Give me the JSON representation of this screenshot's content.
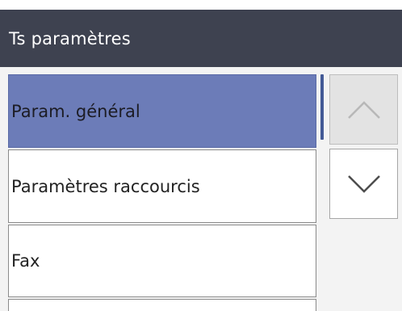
{
  "header": {
    "title": "Ts paramètres"
  },
  "menu": {
    "items": [
      {
        "label": "Param. général",
        "selected": true
      },
      {
        "label": "Paramètres raccourcis",
        "selected": false
      },
      {
        "label": "Fax",
        "selected": false
      },
      {
        "label": "",
        "selected": false
      }
    ]
  },
  "controls": {
    "scroll_up": {
      "icon": "chevron-up-icon",
      "enabled": false
    },
    "scroll_down": {
      "icon": "chevron-down-icon",
      "enabled": true
    }
  },
  "colors": {
    "title_bar": "#3e4250",
    "selected_item": "#6c7cb8",
    "scroll_indicator": "#435a96"
  }
}
